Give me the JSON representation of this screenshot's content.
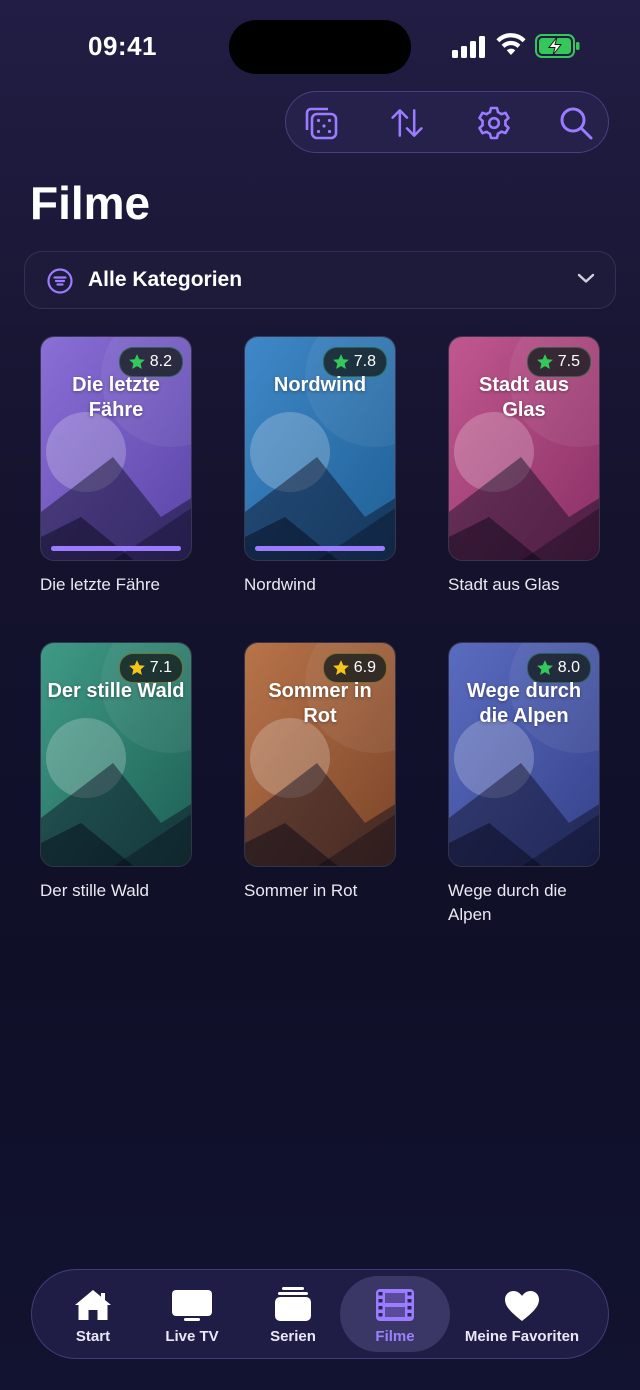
{
  "status_bar": {
    "time": "09:41"
  },
  "colors": {
    "accent": "#9b7bff",
    "star_green": "#34c759",
    "star_yellow": "#f5c518"
  },
  "toolbar": {
    "buttons": [
      {
        "name": "random",
        "icon": "dice-icon"
      },
      {
        "name": "sort",
        "icon": "sort-arrows-icon"
      },
      {
        "name": "settings",
        "icon": "gear-icon"
      },
      {
        "name": "search",
        "icon": "search-icon"
      }
    ]
  },
  "page": {
    "title": "Filme"
  },
  "category": {
    "label": "Alle Kategorien",
    "icon": "filter-icon"
  },
  "movies": [
    {
      "poster_title": "Die letzte Fähre",
      "rating": "8.2",
      "star": "green",
      "caption": "Die letzte Fähre",
      "progress": 1.0,
      "palette": [
        "#8a6fd6",
        "#5a44a6"
      ]
    },
    {
      "poster_title": "Nordwind",
      "rating": "7.8",
      "star": "green",
      "caption": "Nordwind",
      "progress": 1.0,
      "palette": [
        "#3f88c8",
        "#1f5f95"
      ]
    },
    {
      "poster_title": "Stadt aus Glas",
      "rating": "7.5",
      "star": "green",
      "caption": "Stadt aus Glas",
      "progress": null,
      "palette": [
        "#c0588f",
        "#8a2f66"
      ]
    },
    {
      "poster_title": "Der stille Wald",
      "rating": "7.1",
      "star": "yellow",
      "caption": "Der stille Wald",
      "progress": null,
      "palette": [
        "#3f9a86",
        "#1d5f54"
      ]
    },
    {
      "poster_title": "Sommer in Rot",
      "rating": "6.9",
      "star": "yellow",
      "caption": "Sommer in Rot",
      "progress": null,
      "palette": [
        "#b8744a",
        "#7a4428"
      ]
    },
    {
      "poster_title": "Wege durch die Alpen",
      "rating": "8.0",
      "star": "green",
      "caption": "Wege durch die Alpen",
      "progress": null,
      "palette": [
        "#5a6cc0",
        "#35418a"
      ]
    }
  ],
  "tabbar": {
    "tabs": [
      {
        "label": "Start",
        "icon": "home-icon",
        "active": false
      },
      {
        "label": "Live TV",
        "icon": "tv-icon",
        "active": false
      },
      {
        "label": "Serien",
        "icon": "stack-icon",
        "active": false
      },
      {
        "label": "Filme",
        "icon": "film-icon",
        "active": true
      },
      {
        "label": "Meine Favoriten",
        "icon": "heart-icon",
        "active": false
      }
    ]
  }
}
